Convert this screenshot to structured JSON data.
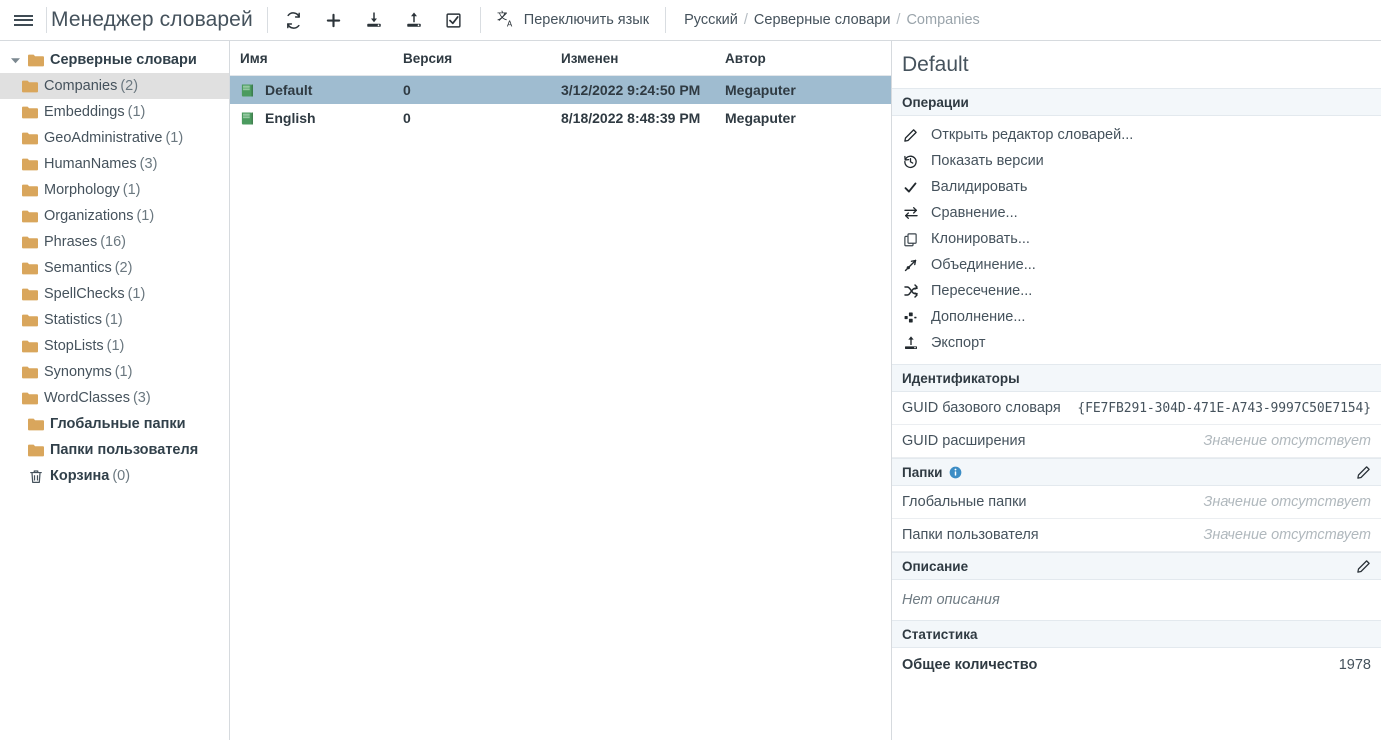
{
  "topbar": {
    "menu_icon": "hamburger-icon",
    "app_title": "Менеджер словарей",
    "tools": [
      {
        "name": "refresh-button",
        "icon": "refresh-icon"
      },
      {
        "name": "add-button",
        "icon": "plus-icon"
      },
      {
        "name": "import-button",
        "icon": "download-icon"
      },
      {
        "name": "export-button",
        "icon": "upload-icon"
      },
      {
        "name": "select-button",
        "icon": "checkbox-checked-icon"
      }
    ],
    "lang_switch_label": "Переключить язык",
    "lang_switch_icon": "translate-icon",
    "breadcrumb": {
      "items": [
        "Русский",
        "Серверные словари",
        "Companies"
      ],
      "separator": "/"
    }
  },
  "sidebar": {
    "root": {
      "label": "Серверные словари",
      "icon": "folder-icon",
      "expanded": true
    },
    "items": [
      {
        "label": "Companies",
        "count": "(2)",
        "icon": "folder-icon",
        "selected": true
      },
      {
        "label": "Embeddings",
        "count": "(1)",
        "icon": "folder-icon",
        "selected": false
      },
      {
        "label": "GeoAdministrative",
        "count": "(1)",
        "icon": "folder-icon",
        "selected": false
      },
      {
        "label": "HumanNames",
        "count": "(3)",
        "icon": "folder-icon",
        "selected": false
      },
      {
        "label": "Morphology",
        "count": "(1)",
        "icon": "folder-icon",
        "selected": false
      },
      {
        "label": "Organizations",
        "count": "(1)",
        "icon": "folder-icon",
        "selected": false
      },
      {
        "label": "Phrases",
        "count": "(16)",
        "icon": "folder-icon",
        "selected": false
      },
      {
        "label": "Semantics",
        "count": "(2)",
        "icon": "folder-icon",
        "selected": false
      },
      {
        "label": "SpellChecks",
        "count": "(1)",
        "icon": "folder-icon",
        "selected": false
      },
      {
        "label": "Statistics",
        "count": "(1)",
        "icon": "folder-icon",
        "selected": false
      },
      {
        "label": "StopLists",
        "count": "(1)",
        "icon": "folder-icon",
        "selected": false
      },
      {
        "label": "Synonyms",
        "count": "(1)",
        "icon": "folder-icon",
        "selected": false
      },
      {
        "label": "WordClasses",
        "count": "(3)",
        "icon": "folder-icon",
        "selected": false
      }
    ],
    "bottom_items": [
      {
        "label": "Глобальные папки",
        "count": "",
        "icon": "folder-icon"
      },
      {
        "label": "Папки пользователя",
        "count": "",
        "icon": "folder-icon"
      },
      {
        "label": "Корзина",
        "count": "(0)",
        "icon": "trash-icon"
      }
    ]
  },
  "table": {
    "columns": [
      "Имя",
      "Версия",
      "Изменен",
      "Автор"
    ],
    "rows": [
      {
        "icon": "book-icon",
        "name": "Default",
        "version": "0",
        "modified": "3/12/2022 9:24:50 PM",
        "author": "Megaputer",
        "selected": true
      },
      {
        "icon": "book-icon",
        "name": "English",
        "version": "0",
        "modified": "8/18/2022 8:48:39 PM",
        "author": "Megaputer",
        "selected": false
      }
    ]
  },
  "details": {
    "title": "Default",
    "operations": {
      "header": "Операции",
      "items": [
        {
          "label": "Открыть редактор словарей...",
          "icon": "pencil-icon"
        },
        {
          "label": "Показать версии",
          "icon": "history-icon"
        },
        {
          "label": "Валидировать",
          "icon": "check-icon"
        },
        {
          "label": "Сравнение...",
          "icon": "compare-arrows-icon"
        },
        {
          "label": "Клонировать...",
          "icon": "copy-icon"
        },
        {
          "label": "Объединение...",
          "icon": "union-icon"
        },
        {
          "label": "Пересечение...",
          "icon": "shuffle-icon"
        },
        {
          "label": "Дополнение...",
          "icon": "complement-icon"
        },
        {
          "label": "Экспорт",
          "icon": "upload-icon"
        }
      ]
    },
    "identifiers": {
      "header": "Идентификаторы",
      "rows": [
        {
          "key": "GUID базового словаря",
          "value": "{FE7FB291-304D-471E-A743-9997C50E7154}",
          "empty": false
        },
        {
          "key": "GUID расширения",
          "value": "Значение отсутствует",
          "empty": true
        }
      ]
    },
    "folders": {
      "header": "Папки",
      "info_icon": "info-icon",
      "edit_icon": "pencil-icon",
      "rows": [
        {
          "key": "Глобальные папки",
          "value": "Значение отсутствует",
          "empty": true
        },
        {
          "key": "Папки пользователя",
          "value": "Значение отсутствует",
          "empty": true
        }
      ]
    },
    "description": {
      "header": "Описание",
      "edit_icon": "pencil-icon",
      "empty_text": "Нет описания"
    },
    "statistics": {
      "header": "Статистика",
      "rows": [
        {
          "key": "Общее количество",
          "value": "1978"
        }
      ]
    }
  },
  "colors": {
    "selected_row": "#9fbcd0",
    "sidebar_selected": "#e0e0e0",
    "folder": "#d9a65c",
    "book": "#4b9b5f",
    "section_header_bg": "#f3f7fa",
    "text": "#45525c",
    "muted": "#b0b8bd"
  }
}
